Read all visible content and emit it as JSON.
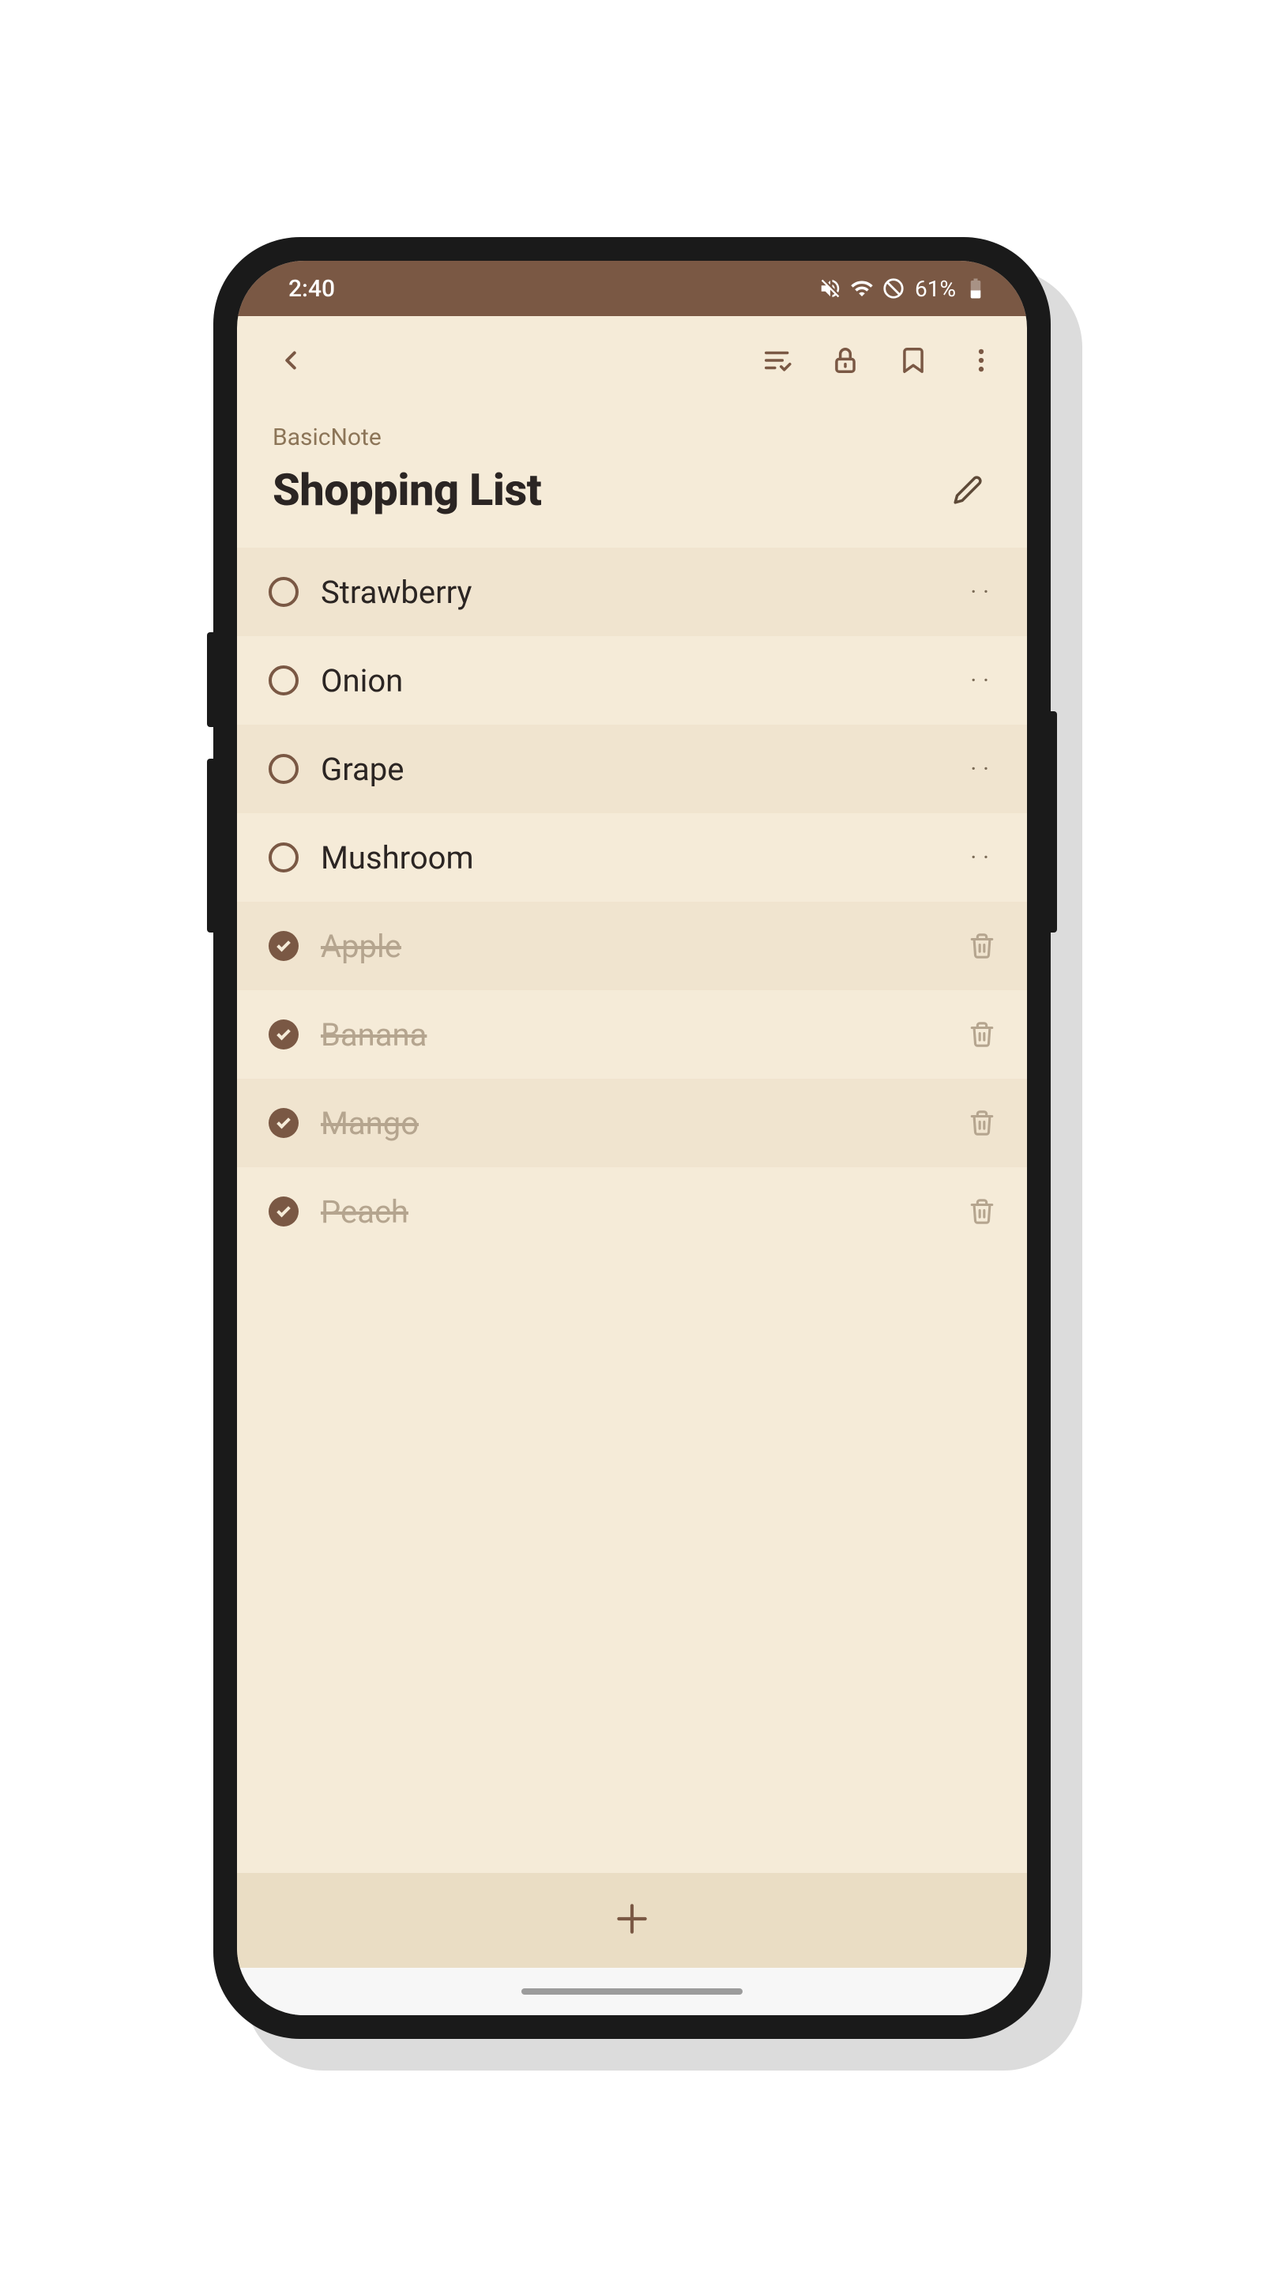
{
  "status": {
    "time": "2:40",
    "battery": "61%"
  },
  "note": {
    "label": "BasicNote",
    "title": "Shopping List"
  },
  "items": [
    {
      "label": "Strawberry",
      "done": false
    },
    {
      "label": "Onion",
      "done": false
    },
    {
      "label": "Grape",
      "done": false
    },
    {
      "label": "Mushroom",
      "done": false
    },
    {
      "label": "Apple",
      "done": true
    },
    {
      "label": "Banana",
      "done": true
    },
    {
      "label": "Mango",
      "done": true
    },
    {
      "label": "Peach",
      "done": true
    }
  ]
}
